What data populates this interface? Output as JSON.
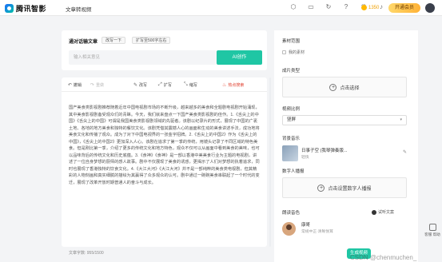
{
  "header": {
    "brand": "腾讯智影",
    "page_name": "文章转视频",
    "coins": "1350",
    "vip_label": "开通会员",
    "icons": [
      "cube-icon",
      "monitor-icon",
      "refresh-icon",
      "help-icon",
      "crown-icon",
      "bell-icon"
    ]
  },
  "prompt_card": {
    "title": "通对话输文章",
    "chip1": "改写一下",
    "chip2": "扩写至500字左右",
    "input_placeholder": "输入相关意见",
    "ai_button": "AI创作"
  },
  "toolbar": {
    "undo": "撤销",
    "redo": "重做",
    "rewrite": "改写",
    "expand": "扩写",
    "condense": "缩写",
    "hot": "热点搜索"
  },
  "article": {
    "text": "国产美食类影视剧推荐随着近年中国电视剧市场的不断升级，越来越多的美食和全题剧电视剧开始涌现，其中美食影视剧备受观众们的青睐。今天，我们就来盘点一下国产美食类影视剧的佳作。1.《舌尖上的中国》《舌尖上的中国》可谓是我国美食类影视剧领域的先驱者。该剧以纪录片的形式，展现了中国的广袤土地、各地的地方美食和独特的餐饮文化。该剧凭借其震撼人心的画面和生动的美食讲述手法，成功地将美食文化和传播了观众。成为了对下中国电视界的一张金字招牌。2.《舌尖上的中国2》作为《舌尖上的中国》，《舌尖上的中国2》更加深入人心。该剧在追求了第一季的传统，用镜头记录了不同区域的特色美食。但是刚比第一季，介绍了更多的传统文化和地方特色，观众不仅可以从画面中看到美食的美味，也可以品味背后的传统文化和历史底蕴。3.《食神》《食神》是一部以香港中美美食行业为主题的电视剧，讲述了一位自身梦想的厨师的感人故事。剧中不仅展现了美食的诱惑，更揭示了人们对梦想的执着追求，同时也展现了香港独特的饮食文化。4.《大江大河》《大江大河》并不是一部纯粹的美食类电视剧，但其精彩的人物刻画和真实细腻的描绘为其赢得了众多观众的认可。剧中通过一碗碗美食串联起了一个时代的变迁，展现了改革开放时期普通人的奋斗与成长。"
  },
  "footer": {
    "word_count": "文章字数: 955/1500",
    "generate_button": "生成视频"
  },
  "settings": {
    "material_scope_label": "素材范围",
    "my_materials": "我的素材",
    "cover_label": "成片类型",
    "cover_upload": "点击选择",
    "ratio_label": "视频比例",
    "ratio_value": "竖屏",
    "music_label": "背景音乐",
    "music_title": "日事子空 (我琴弹奏版...",
    "music_sub": "轻快",
    "digital_human_label": "数字人播报",
    "digital_human_add": "点击设置数字人播报",
    "narrator_label": "朗读音色",
    "listen_label": "试听文案",
    "narrator_name": "康哥",
    "narrator_sub": "常规中正·清晰悦耳"
  },
  "rail": {
    "label": "客服 帮助"
  },
  "watermark": "CSDN @chenmuchen_"
}
